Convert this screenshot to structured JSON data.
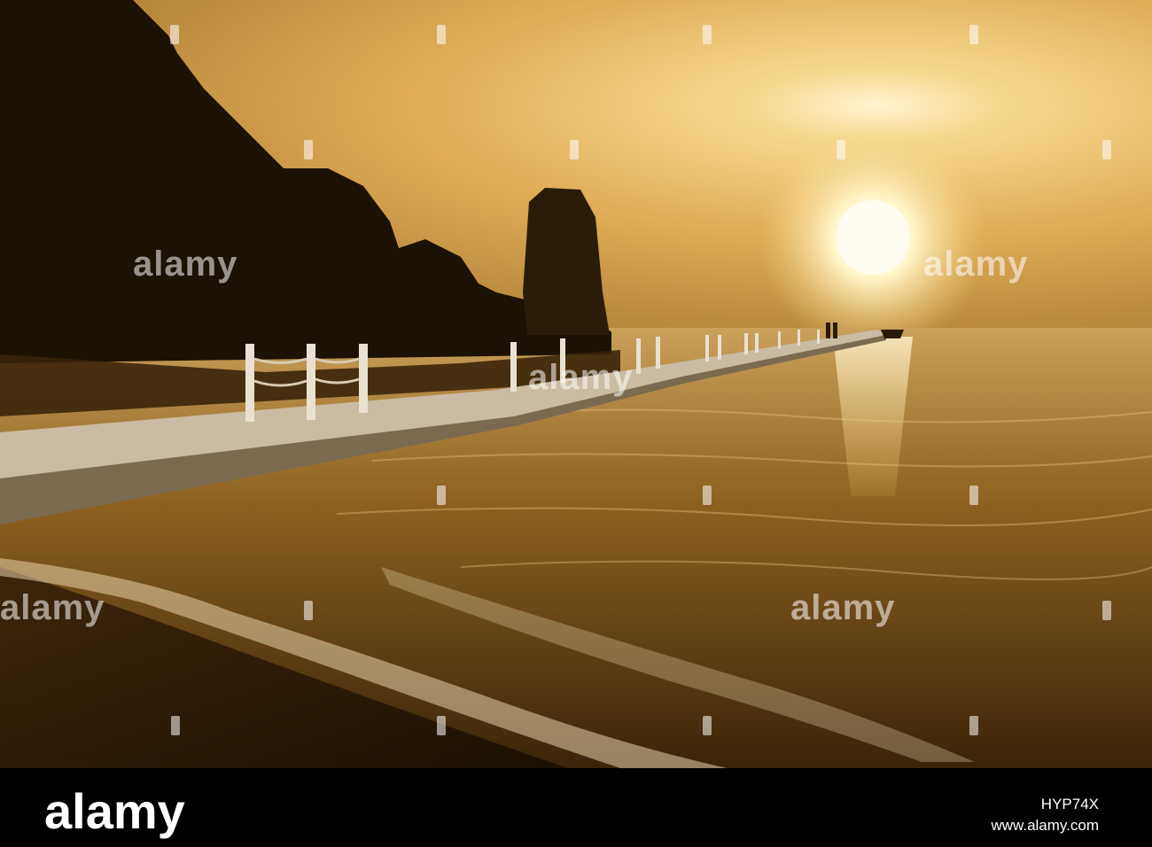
{
  "photo": {
    "subject": "sunset-over-sea-with-floating-pontoon-pier"
  },
  "watermark": {
    "text": "alamy"
  },
  "footer": {
    "brand": "alamy",
    "image_id": "HYP74X",
    "url": "www.alamy.com"
  },
  "colors": {
    "sky_top": "#b98a35",
    "sky_glow": "#f6d48a",
    "sun": "#fffbe8",
    "sea": "#8a5d1a",
    "footer_bg": "#000000"
  }
}
